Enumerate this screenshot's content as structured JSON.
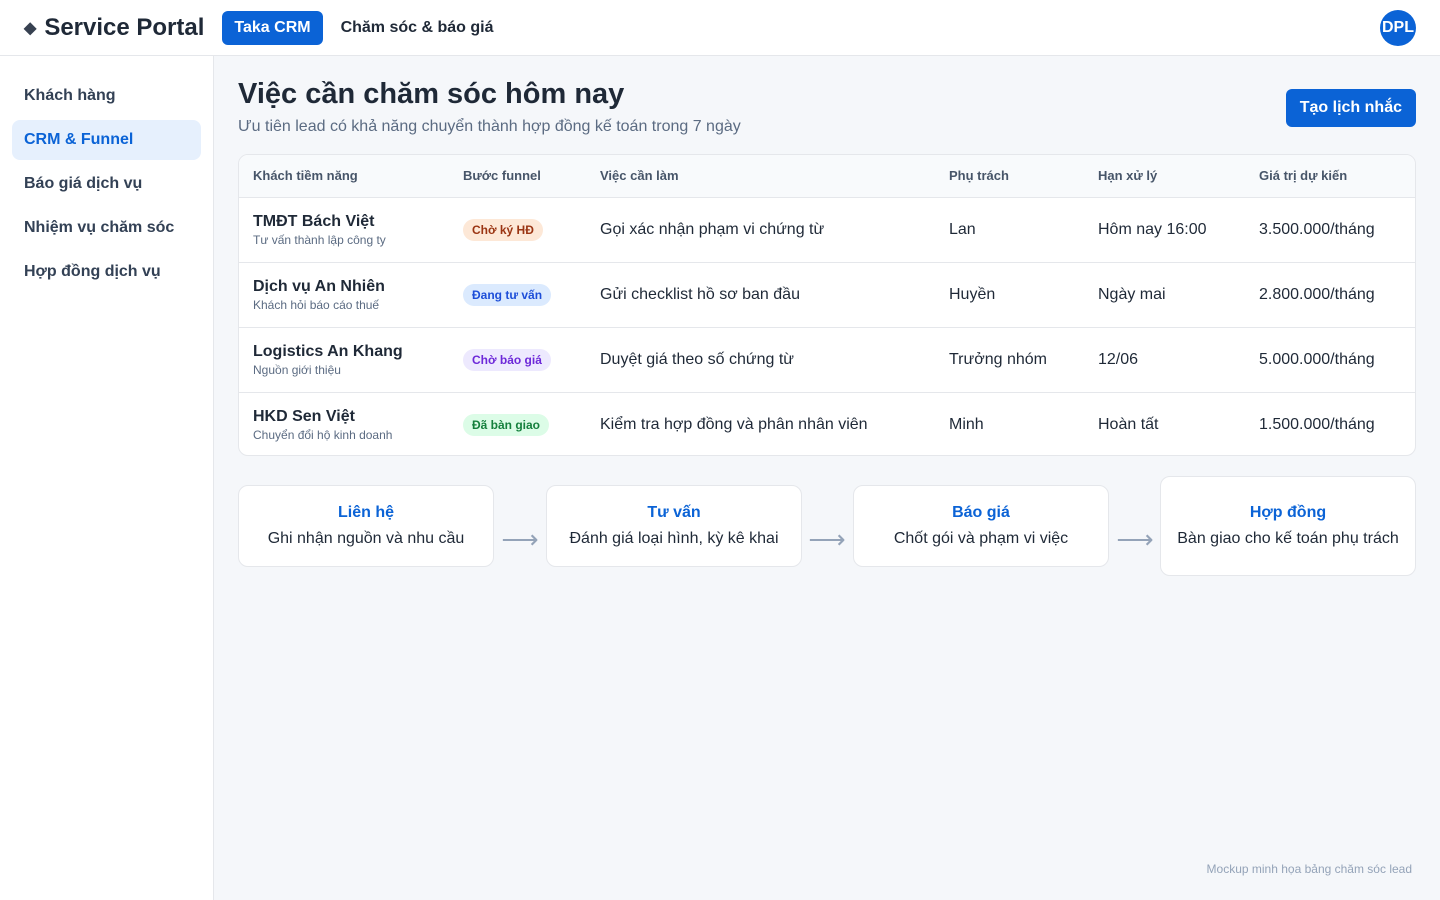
{
  "app": {
    "brand_icon": "◆",
    "brand": "Service Portal",
    "tabs": [
      {
        "label": "Taka CRM"
      },
      {
        "label": "Chăm sóc & báo giá"
      }
    ],
    "avatar": "DPL"
  },
  "sidebar": {
    "items": [
      {
        "label": "Khách hàng"
      },
      {
        "label": "CRM & Funnel"
      },
      {
        "label": "Báo giá dịch vụ"
      },
      {
        "label": "Nhiệm vụ chăm sóc"
      },
      {
        "label": "Hợp đồng dịch vụ"
      }
    ]
  },
  "page": {
    "title": "Việc cần chăm sóc hôm nay",
    "subtitle": "Ưu tiên lead có khả năng chuyển thành hợp đồng kế toán trong 7 ngày",
    "action_button": "Tạo lịch nhắc"
  },
  "table": {
    "headers": [
      "Khách tiềm năng",
      "Bước funnel",
      "Việc cần làm",
      "Phụ trách",
      "Hạn xử lý",
      "Giá trị dự kiến"
    ],
    "rows": [
      {
        "name": "TMĐT Bách Việt",
        "note": "Tư vấn thành lập công ty",
        "stage": "Chờ ký HĐ",
        "stage_bg": "#fde8d7",
        "stage_color": "#9a3412",
        "task": "Gọi xác nhận phạm vi chứng từ",
        "owner": "Lan",
        "due": "Hôm nay 16:00",
        "value": "3.500.000/tháng"
      },
      {
        "name": "Dịch vụ An Nhiên",
        "note": "Khách hỏi báo cáo thuế",
        "stage": "Đang tư vấn",
        "stage_bg": "#dbeafe",
        "stage_color": "#1d4ed8",
        "task": "Gửi checklist hồ sơ ban đầu",
        "owner": "Huyền",
        "due": "Ngày mai",
        "value": "2.800.000/tháng"
      },
      {
        "name": "Logistics An Khang",
        "note": "Nguồn giới thiệu",
        "stage": "Chờ báo giá",
        "stage_bg": "#ede9fe",
        "stage_color": "#6d28d9",
        "task": "Duyệt giá theo số chứng từ",
        "owner": "Trưởng nhóm",
        "due": "12/06",
        "value": "5.000.000/tháng"
      },
      {
        "name": "HKD Sen Việt",
        "note": "Chuyển đổi hộ kinh doanh",
        "stage": "Đã bàn giao",
        "stage_bg": "#dcfce7",
        "stage_color": "#15803d",
        "task": "Kiểm tra hợp đồng và phân nhân viên",
        "owner": "Minh",
        "due": "Hoàn tất",
        "value": "1.500.000/tháng"
      }
    ]
  },
  "funnel": {
    "arrow": "⟶",
    "steps": [
      {
        "title": "Liên hệ",
        "desc": "Ghi nhận nguồn và nhu cầu"
      },
      {
        "title": "Tư vấn",
        "desc": "Đánh giá loại hình, kỳ kê khai"
      },
      {
        "title": "Báo giá",
        "desc": "Chốt gói và phạm vi việc"
      },
      {
        "title": "Hợp đồng",
        "desc": "Bàn giao cho kế toán phụ trách"
      }
    ]
  },
  "footnote": "Mockup minh họa bảng chăm sóc lead",
  "colors": {
    "accent": "#0b63d6",
    "sidebar_active_bg": "#e6f0fd"
  }
}
